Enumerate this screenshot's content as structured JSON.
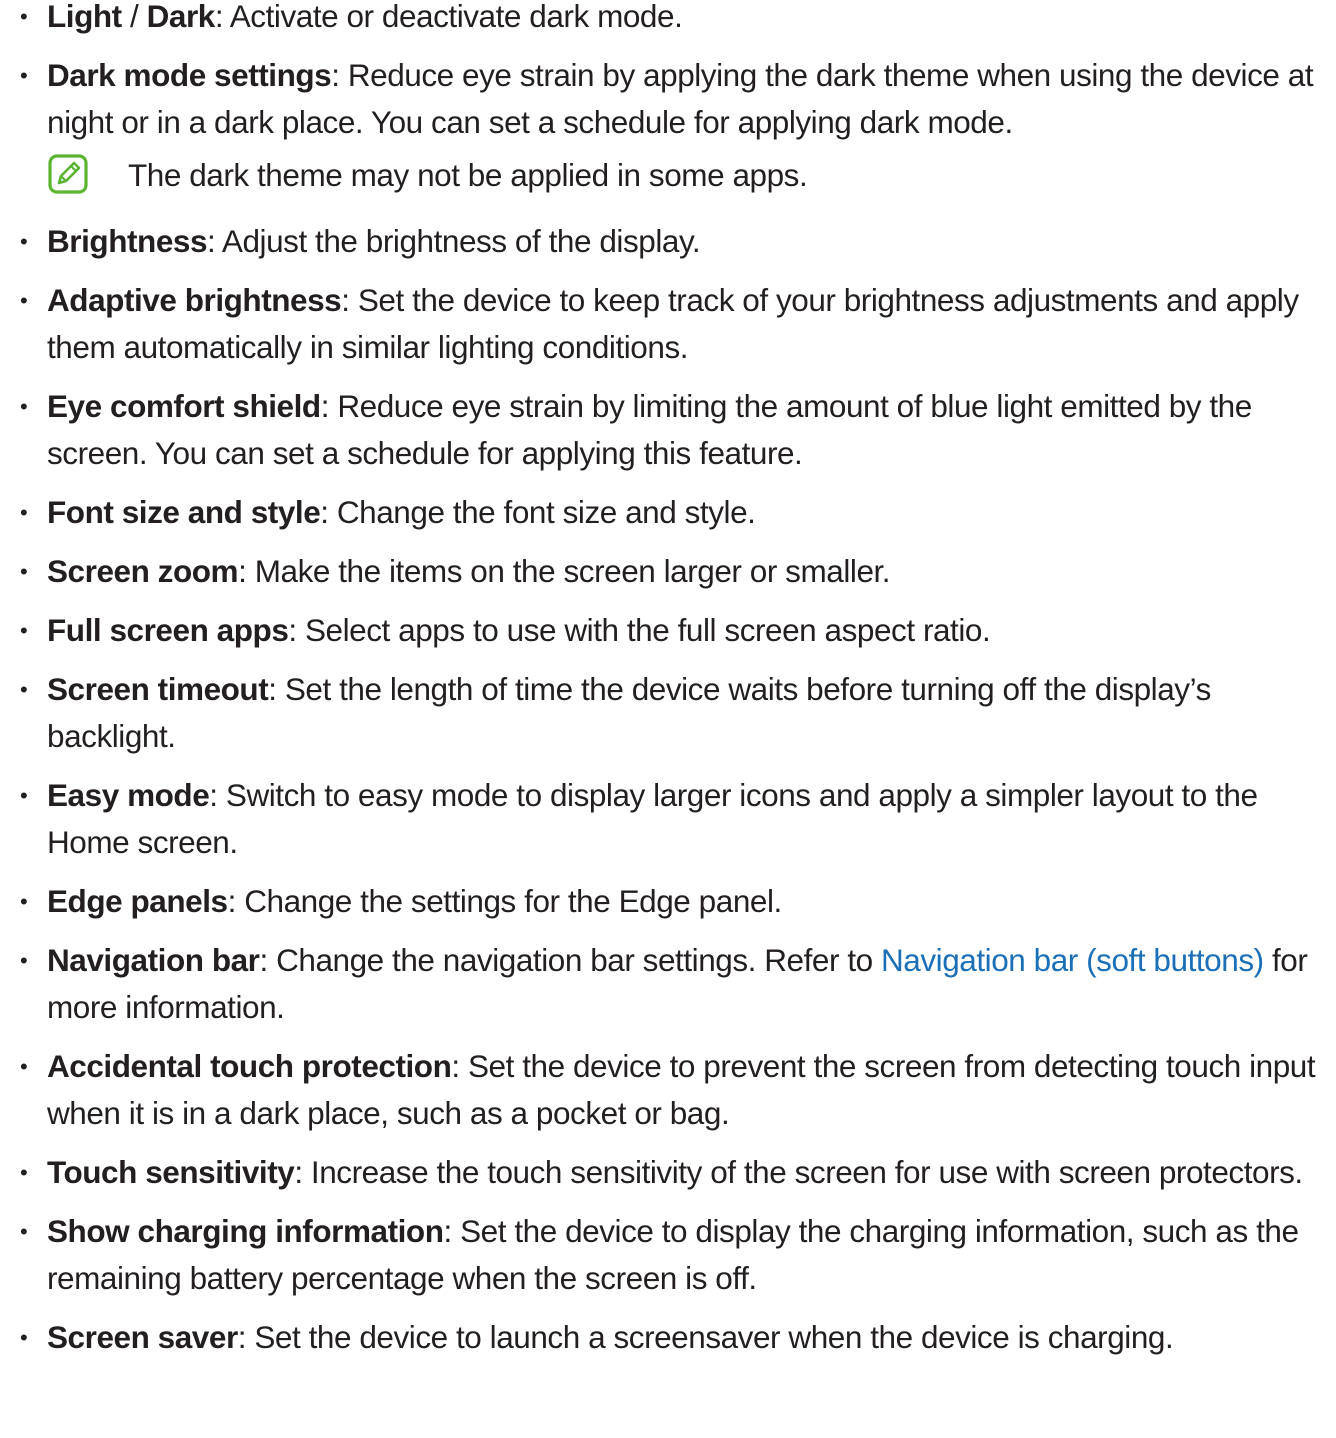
{
  "items": [
    {
      "bullet": "•",
      "term_a": "Light",
      "sep": " / ",
      "term_b": "Dark",
      "desc": ": Activate or deactivate dark mode."
    },
    {
      "bullet": "•",
      "term": "Dark mode settings",
      "desc": ": Reduce eye strain by applying the dark theme when using the device at night or in a dark place. You can set a schedule for applying dark mode."
    },
    {
      "bullet": "•",
      "term": "Brightness",
      "desc": ": Adjust the brightness of the display."
    },
    {
      "bullet": "•",
      "term": "Adaptive brightness",
      "desc": ": Set the device to keep track of your brightness adjustments and apply them automatically in similar lighting conditions."
    },
    {
      "bullet": "•",
      "term": "Eye comfort shield",
      "desc": ": Reduce eye strain by limiting the amount of blue light emitted by the screen. You can set a schedule for applying this feature."
    },
    {
      "bullet": "•",
      "term": "Font size and style",
      "desc": ": Change the font size and style."
    },
    {
      "bullet": "•",
      "term": "Screen zoom",
      "desc": ": Make the items on the screen larger or smaller."
    },
    {
      "bullet": "•",
      "term": "Full screen apps",
      "desc": ": Select apps to use with the full screen aspect ratio."
    },
    {
      "bullet": "•",
      "term": "Screen timeout",
      "desc": ": Set the length of time the device waits before turning off the display’s backlight."
    },
    {
      "bullet": "•",
      "term": "Easy mode",
      "desc": ": Switch to easy mode to display larger icons and apply a simpler layout to the Home screen."
    },
    {
      "bullet": "•",
      "term": "Edge panels",
      "desc": ": Change the settings for the Edge panel."
    },
    {
      "bullet": "•",
      "term": "Navigation bar",
      "desc_pre": ": Change the navigation bar settings. Refer to ",
      "link": "Navigation bar (soft buttons)",
      "desc_post": " for more information."
    },
    {
      "bullet": "•",
      "term": "Accidental touch protection",
      "desc": ": Set the device to prevent the screen from detecting touch input when it is in a dark place, such as a pocket or bag."
    },
    {
      "bullet": "•",
      "term": "Touch sensitivity",
      "desc": ": Increase the touch sensitivity of the screen for use with screen protectors."
    },
    {
      "bullet": "•",
      "term": "Show charging information",
      "desc": ": Set the device to display the charging information, such as the remaining battery percentage when the screen is off."
    },
    {
      "bullet": "•",
      "term": "Screen saver",
      "desc": ": Set the device to launch a screensaver when the device is charging."
    }
  ],
  "note": {
    "icon": "note-pencil-icon",
    "text": "The dark theme may not be applied in some apps."
  },
  "colors": {
    "text": "#231f20",
    "link": "#1a6fb7",
    "note_icon": "#5cb531"
  }
}
